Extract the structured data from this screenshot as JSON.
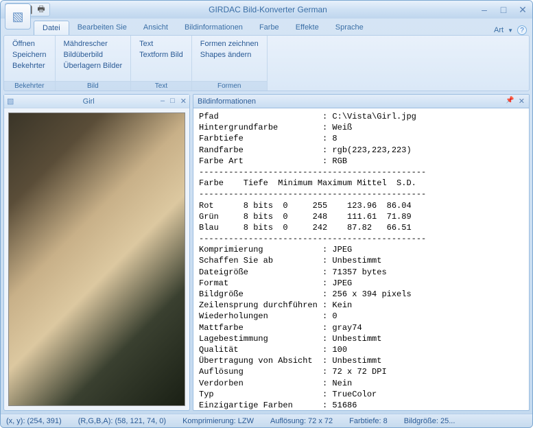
{
  "title": "GIRDAC Bild-Konverter German",
  "tabs": {
    "items": [
      "Datei",
      "Bearbeiten Sie",
      "Ansicht",
      "Bildinformationen",
      "Farbe",
      "Effekte",
      "Sprache"
    ],
    "active": 0,
    "right_label": "Art"
  },
  "ribbon": {
    "groups": [
      {
        "label": "Bekehrter",
        "items": [
          "Öffnen",
          "Speichern",
          "Bekehrter"
        ]
      },
      {
        "label": "Bild",
        "items": [
          "Mähdrescher",
          "Bildüberbild",
          "Überlagern Bilder"
        ]
      },
      {
        "label": "Text",
        "items": [
          "Text",
          "Textform Bild"
        ]
      },
      {
        "label": "Formen",
        "items": [
          "Formen zeichnen",
          "Shapes ändern"
        ]
      }
    ]
  },
  "child_window": {
    "title": "Girl"
  },
  "info_panel": {
    "title": "Bildinformationen",
    "rows1": [
      [
        "Pfad",
        "C:\\Vista\\Girl.jpg"
      ],
      [
        "Hintergrundfarbe",
        "Weiß"
      ],
      [
        "Farbtiefe",
        "8"
      ],
      [
        "Randfarbe",
        "rgb(223,223,223)"
      ],
      [
        "Farbe Art",
        "RGB"
      ]
    ],
    "color_header": [
      "Farbe",
      "Tiefe",
      "Minimum",
      "Maximum",
      "Mittel",
      "S.D."
    ],
    "color_rows": [
      [
        "Rot",
        "8 bits",
        "0",
        "255",
        "123.96",
        "86.04"
      ],
      [
        "Grün",
        "8 bits",
        "0",
        "248",
        "111.61",
        "71.89"
      ],
      [
        "Blau",
        "8 bits",
        "0",
        "242",
        "87.82",
        "66.51"
      ]
    ],
    "rows2": [
      [
        "Komprimierung",
        "JPEG"
      ],
      [
        "Schaffen Sie ab",
        "Unbestimmt"
      ],
      [
        "Dateigröße",
        "71357 bytes"
      ],
      [
        "Format",
        "JPEG"
      ],
      [
        "Bildgröße",
        "256 x 394 pixels"
      ],
      [
        "Zeilensprung durchführen",
        "Kein"
      ],
      [
        "Wiederholungen",
        "0"
      ],
      [
        "Mattfarbe",
        "gray74"
      ],
      [
        "Lagebestimmung",
        "Unbestimmt"
      ],
      [
        "Qualität",
        "100"
      ],
      [
        "Übertragung von Absicht",
        "Unbestimmt"
      ],
      [
        "Auflösung",
        "72 x 72 DPI"
      ],
      [
        "Verdorben",
        "Nein"
      ],
      [
        "Typ",
        "TrueColor"
      ],
      [
        "Einzigartige Farben",
        "51686"
      ]
    ]
  },
  "statusbar": {
    "xy": "(x, y): (254, 391)",
    "rgba": "(R,G,B,A): (58, 121, 74, 0)",
    "compression": "Komprimierung: LZW",
    "resolution": "Auflösung: 72 x 72",
    "depth": "Farbtiefe: 8",
    "size": "Bildgröße: 25..."
  }
}
